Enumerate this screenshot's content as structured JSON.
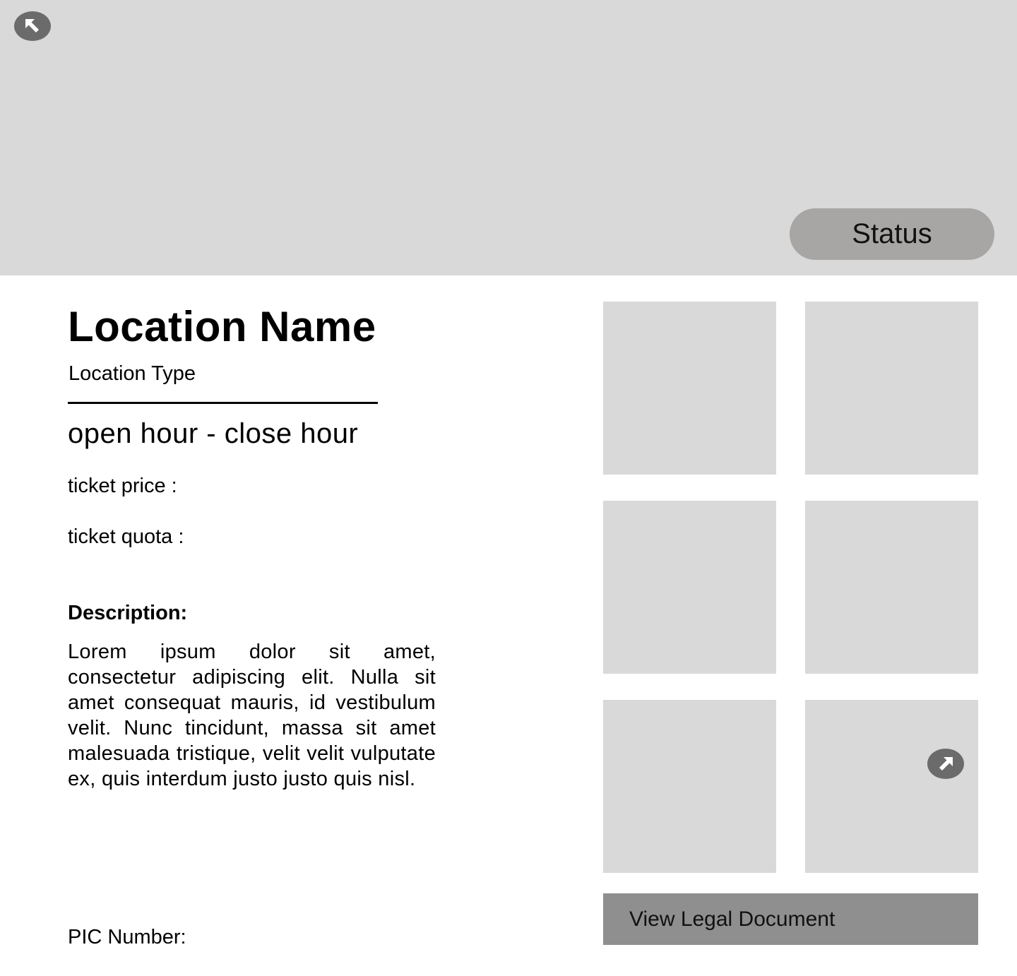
{
  "header": {
    "back_icon": "arrow-up-left-icon",
    "status_label": "Status"
  },
  "location": {
    "name": "Location Name",
    "type": "Location Type",
    "hours": "open hour - close hour",
    "ticket_price_label": "ticket price :",
    "ticket_quota_label": "ticket quota :",
    "description_heading": "Description:",
    "description_text": "Lorem ipsum dolor sit amet, consectetur adipiscing elit. Nulla sit amet consequat mauris, id vestibulum velit. Nunc tincidunt, massa sit amet malesuada tristique, velit velit vulputate ex, quis interdum justo justo quis nisl.",
    "pic_number_label": "PIC Number:"
  },
  "gallery": {
    "tile_count": 6,
    "next_icon": "arrow-up-right-icon"
  },
  "actions": {
    "legal_document_label": "View Legal Document"
  },
  "colors": {
    "banner": "#d9d9d9",
    "status_pill": "#a8a5a5",
    "icon_button": "#6b6b6b",
    "legal_button": "#8f8f8f",
    "image_placeholder": "#d9d9d9"
  }
}
